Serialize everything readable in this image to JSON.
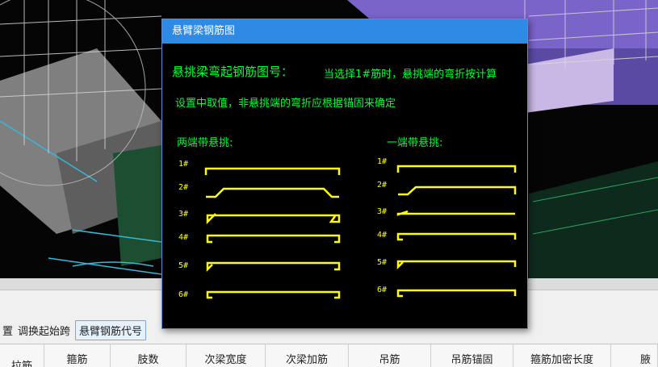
{
  "dialog": {
    "title": "悬臂梁钢筋图",
    "heading": "悬挑梁弯起钢筋图号：",
    "note_line1": "当选择1#筋时，悬挑端的弯折按计算",
    "note_line2": "设置中取值，非悬挑端的弯折应根据锚固来确定",
    "left_group_label": "两端带悬挑:",
    "right_group_label": "一端带悬挑:",
    "left_numbers": [
      "1#",
      "2#",
      "3#",
      "4#",
      "5#",
      "6#"
    ],
    "right_numbers": [
      "1#",
      "2#",
      "3#",
      "4#",
      "5#",
      "6#"
    ]
  },
  "toolbar": {
    "item_partial": "置",
    "swap_start_span": "调换起始跨",
    "cantilever_code_button": "悬臂钢筋代号"
  },
  "grid_columns": [
    "拉筋",
    "箍筋",
    "肢数",
    "次梁宽度",
    "次梁加筋",
    "吊筋",
    "吊筋锚固",
    "箍筋加密长度",
    "腋"
  ],
  "colors": {
    "dialog_title_bar": "#2f8ae5",
    "text_green": "#00ff33",
    "rebar_yellow": "#ffff00",
    "dialog_background": "#000000"
  }
}
